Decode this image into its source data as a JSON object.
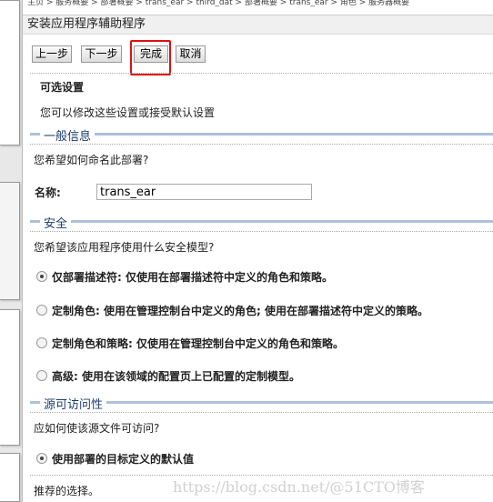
{
  "breadcrumb": "主页 > 服务概要 > 部署概要 > trans_ear > third_dat > 部署概要 > trans_ear > 角色 > 服务器概要",
  "title": "安装应用程序辅助程序",
  "buttons": {
    "prev": "上一步",
    "next": "下一步",
    "finish": "完成",
    "cancel": "取消"
  },
  "optional": {
    "heading": "可选设置",
    "desc": "您可以修改这些设置或接受默认设置"
  },
  "general": {
    "legend": "一般信息",
    "question": "您希望如何命名此部署?",
    "name_label": "名称:",
    "name_value": "trans_ear"
  },
  "security": {
    "legend": "安全",
    "question": "您希望该应用程序使用什么安全模型?",
    "options": [
      {
        "label": "仅部署描述符: 仅使用在部署描述符中定义的角色和策略。",
        "selected": true
      },
      {
        "label": "定制角色: 使用在管理控制台中定义的角色; 使用在部署描述符中定义的策略。",
        "selected": false
      },
      {
        "label": "定制角色和策略: 仅使用在管理控制台中定义的角色和策略。",
        "selected": false
      },
      {
        "label": "高级: 使用在该领域的配置页上已配置的定制模型。",
        "selected": false
      }
    ]
  },
  "source": {
    "legend": "源可访问性",
    "question": "应如何使该源文件可访问?",
    "option": "使用部署的目标定义的默认值",
    "hint": "推荐的选择。"
  },
  "watermark": "https://blog.csdn.net/@51CTO博客",
  "colors": {
    "highlight": "#e01010",
    "legend_line": "#aec1d6"
  }
}
